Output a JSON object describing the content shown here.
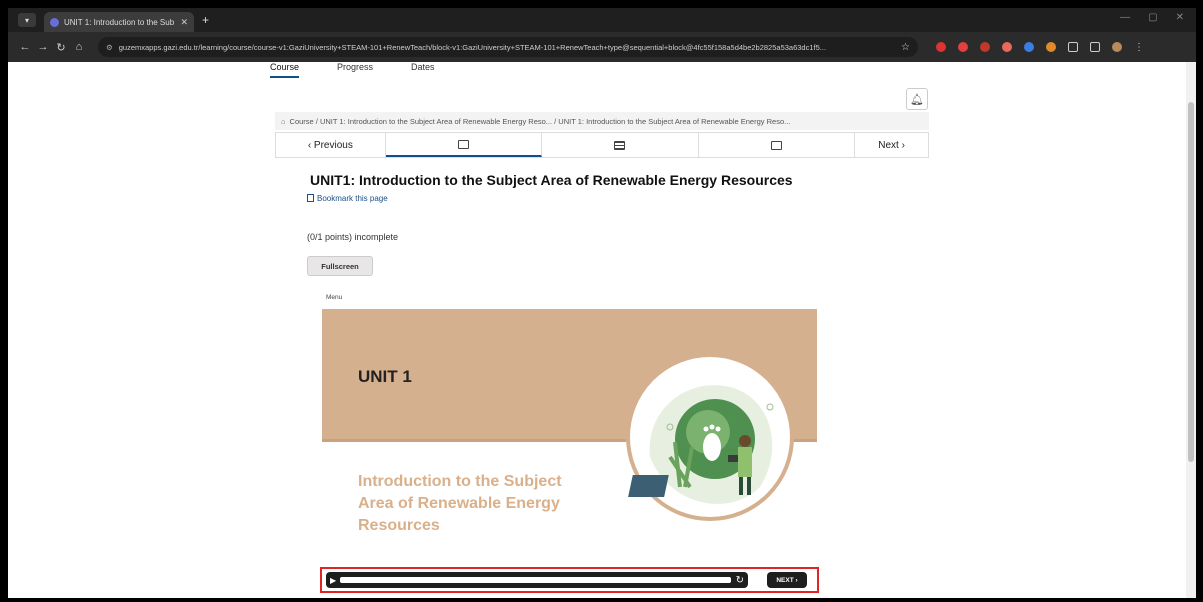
{
  "browser": {
    "tab_title": "UNIT 1: Introduction to the Sub",
    "url": "guzemxapps.gazi.edu.tr/learning/course/course-v1:GaziUniversity+STEAM-101+RenewTeach/block-v1:GaziUniversity+STEAM-101+RenewTeach+type@sequential+block@4fc55f158a5d4be2b2825a53a63dc1f5..."
  },
  "course_nav": {
    "course": "Course",
    "progress": "Progress",
    "dates": "Dates"
  },
  "breadcrumb": {
    "text": "Course / UNIT 1: Introduction to the Subject Area of Renewable Energy Reso... / UNIT 1: Introduction to the Subject Area of Renewable Energy Reso..."
  },
  "sequence_nav": {
    "previous": "‹ Previous",
    "next": "Next ›"
  },
  "content": {
    "title": "UNIT1: Introduction to the Subject Area of Renewable Energy Resources",
    "bookmark": "Bookmark this page",
    "points": "(0/1 points) incomplete",
    "fullscreen": "Fullscreen",
    "menu": "Menu"
  },
  "slide": {
    "unit": "UNIT 1",
    "subtitle_line1": "Introduction to the Subject",
    "subtitle_line2": "Area of Renewable Energy",
    "subtitle_line3": "Resources"
  },
  "player": {
    "next": "NEXT ›"
  },
  "colors": {
    "slide_band": "#d5b08e",
    "subtitle": "#d9b08a",
    "highlight_outline": "#e02525"
  }
}
